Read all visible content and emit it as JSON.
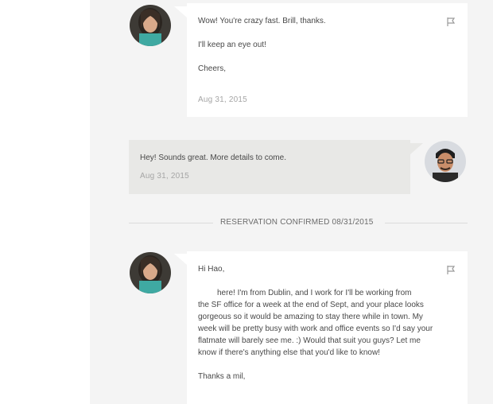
{
  "thread": {
    "message1": {
      "author": "guest",
      "lines": [
        "Wow! You're crazy fast. Brill, thanks.",
        "I'll keep an eye out!",
        "Cheers,"
      ],
      "date": "Aug 31, 2015"
    },
    "message2": {
      "author": "host",
      "text": "Hey! Sounds great. More details to come.",
      "date": "Aug 31, 2015"
    },
    "divider": {
      "label": "RESERVATION CONFIRMED 08/31/2015"
    },
    "message3": {
      "author": "guest",
      "greeting": "Hi Hao,",
      "body_lines": [
        "here! I'm from Dublin, and I work for           I'll be working from",
        "the SF office for a week at the end of Sept, and your place looks",
        "gorgeous so it would be amazing to stay there while in town. My",
        "week will be pretty busy with work and office events so I'd say your",
        "flatmate will barely see me. :) Would that suit you guys? Let me",
        "know if there's anything else that you'd like to know!"
      ],
      "closing": "Thanks a mil,"
    }
  },
  "icons": {
    "flag": "flag-icon"
  },
  "colors": {
    "panel_bg": "#f4f4f4",
    "bubble_bg": "#ffffff",
    "host_bubble_bg": "#e8e8e6",
    "date_text": "#a5a5a5"
  }
}
